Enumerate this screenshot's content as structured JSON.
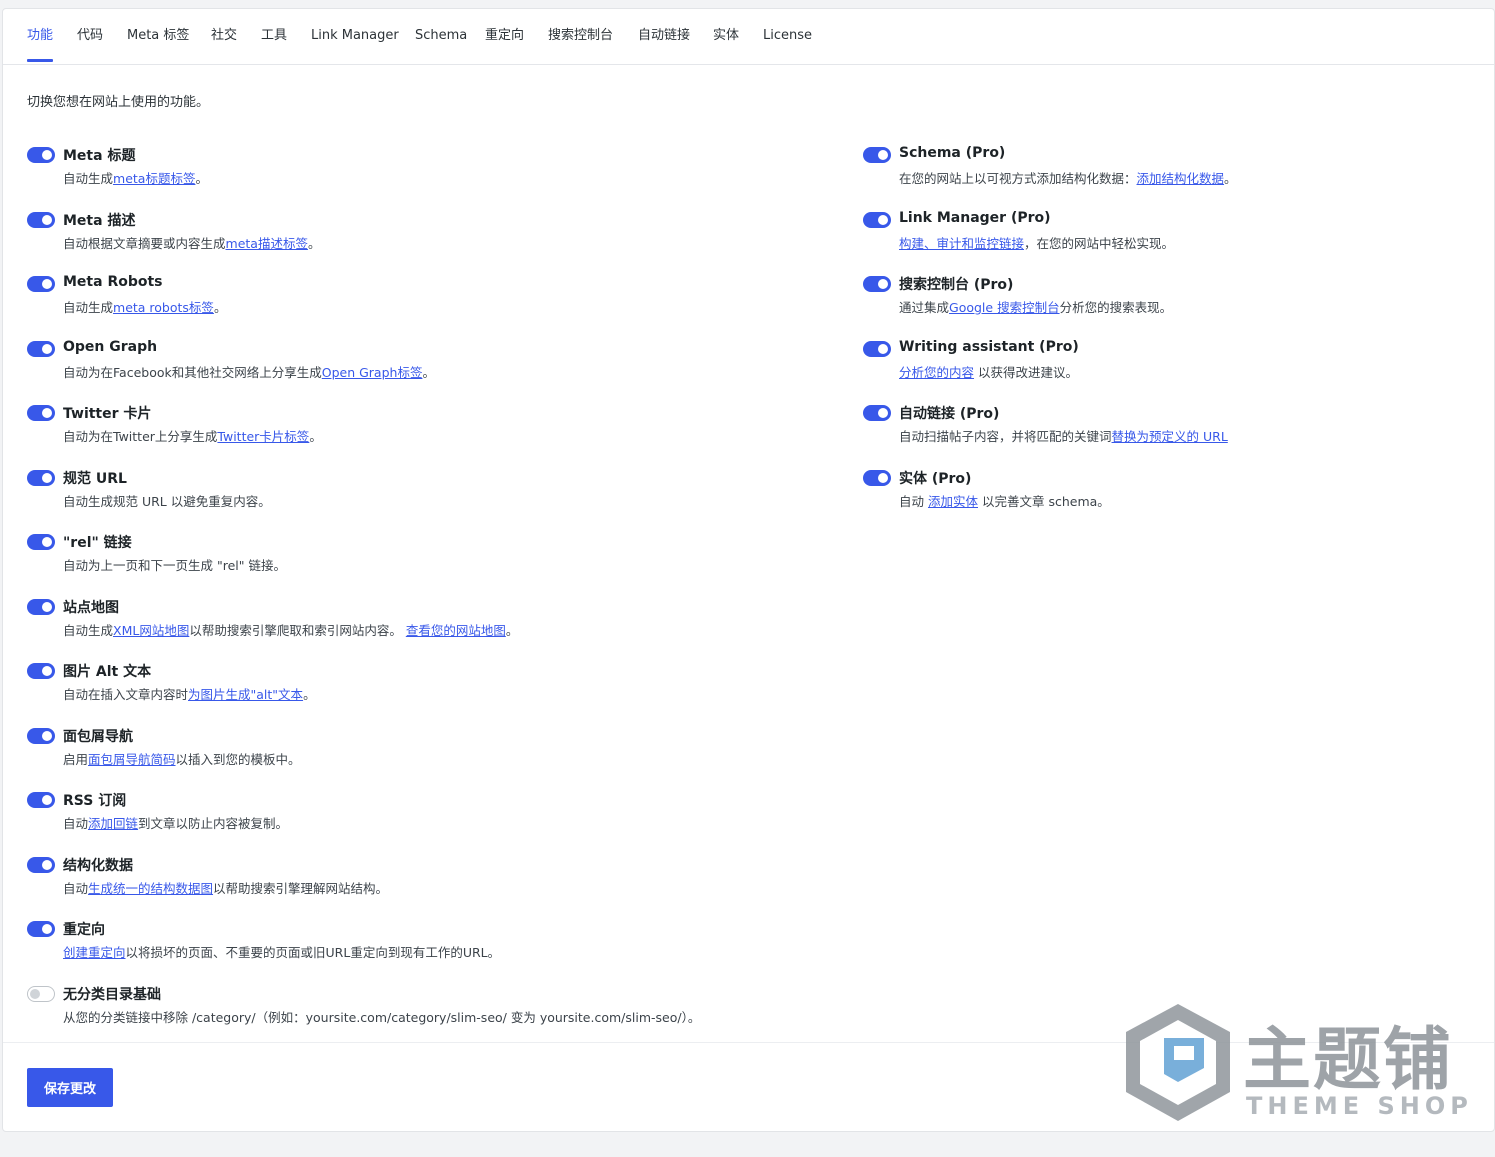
{
  "tabs": [
    "功能",
    "代码",
    "Meta 标签",
    "社交",
    "工具",
    "Link Manager",
    "Schema",
    "重定向",
    "搜索控制台",
    "自动链接",
    "实体",
    "License"
  ],
  "intro": "切换您想在网站上使用的功能。",
  "left_features": [
    {
      "title": "Meta 标题",
      "enabled": true,
      "desc": [
        {
          "t": "自动生成"
        },
        {
          "t": "meta标题标签",
          "link": true
        },
        {
          "t": "。"
        }
      ]
    },
    {
      "title": "Meta 描述",
      "enabled": true,
      "desc": [
        {
          "t": "自动根据文章摘要或内容生成"
        },
        {
          "t": "meta描述标签",
          "link": true
        },
        {
          "t": "。"
        }
      ]
    },
    {
      "title": "Meta Robots",
      "enabled": true,
      "desc": [
        {
          "t": "自动生成"
        },
        {
          "t": "meta robots标签",
          "link": true
        },
        {
          "t": "。"
        }
      ]
    },
    {
      "title": "Open Graph",
      "enabled": true,
      "desc": [
        {
          "t": "自动为在Facebook和其他社交网络上分享生成"
        },
        {
          "t": "Open Graph标签",
          "link": true
        },
        {
          "t": "。"
        }
      ]
    },
    {
      "title": "Twitter 卡片",
      "enabled": true,
      "desc": [
        {
          "t": "自动为在Twitter上分享生成"
        },
        {
          "t": "Twitter卡片标签",
          "link": true
        },
        {
          "t": "。"
        }
      ]
    },
    {
      "title": "规范 URL",
      "enabled": true,
      "desc": [
        {
          "t": "自动生成规范 URL 以避免重复内容。"
        }
      ]
    },
    {
      "title": "\"rel\" 链接",
      "enabled": true,
      "desc": [
        {
          "t": "自动为上一页和下一页生成 \"rel\" 链接。"
        }
      ]
    },
    {
      "title": "站点地图",
      "enabled": true,
      "desc": [
        {
          "t": "自动生成"
        },
        {
          "t": "XML网站地图",
          "link": true
        },
        {
          "t": "以帮助搜索引擎爬取和索引网站内容。 "
        },
        {
          "t": "查看您的网站地图",
          "link": true
        },
        {
          "t": "。"
        }
      ]
    },
    {
      "title": "图片 Alt 文本",
      "enabled": true,
      "desc": [
        {
          "t": "自动在插入文章内容时"
        },
        {
          "t": "为图片生成\"alt\"文本",
          "link": true
        },
        {
          "t": "。"
        }
      ]
    },
    {
      "title": "面包屑导航",
      "enabled": true,
      "desc": [
        {
          "t": "启用"
        },
        {
          "t": "面包屑导航简码",
          "link": true
        },
        {
          "t": "以插入到您的模板中。"
        }
      ]
    },
    {
      "title": "RSS 订阅",
      "enabled": true,
      "desc": [
        {
          "t": "自动"
        },
        {
          "t": "添加回链",
          "link": true
        },
        {
          "t": "到文章以防止内容被复制。"
        }
      ]
    },
    {
      "title": "结构化数据",
      "enabled": true,
      "desc": [
        {
          "t": "自动"
        },
        {
          "t": "生成统一的结构数据图",
          "link": true
        },
        {
          "t": "以帮助搜索引擎理解网站结构。"
        }
      ]
    },
    {
      "title": "重定向",
      "enabled": true,
      "desc": [
        {
          "t": "创建重定向",
          "link": true
        },
        {
          "t": "以将损坏的页面、不重要的页面或旧URL重定向到现有工作的URL。"
        }
      ]
    },
    {
      "title": "无分类目录基础",
      "enabled": false,
      "desc": [
        {
          "t": "从您的分类链接中移除 /category/（例如：yoursite.com/category/slim-seo/ 变为 yoursite.com/slim-seo/）。"
        }
      ]
    }
  ],
  "right_features": [
    {
      "title": "Schema (Pro)",
      "enabled": true,
      "desc": [
        {
          "t": "在您的网站上以可视方式添加结构化数据："
        },
        {
          "t": "添加结构化数据",
          "link": true
        },
        {
          "t": "。"
        }
      ]
    },
    {
      "title": "Link Manager (Pro)",
      "enabled": true,
      "desc": [
        {
          "t": "构建、审计和监控链接",
          "link": true
        },
        {
          "t": "，在您的网站中轻松实现。"
        }
      ]
    },
    {
      "title": "搜索控制台 (Pro)",
      "enabled": true,
      "desc": [
        {
          "t": "通过集成"
        },
        {
          "t": "Google 搜索控制台",
          "link": true
        },
        {
          "t": "分析您的搜索表现。"
        }
      ]
    },
    {
      "title": "Writing assistant (Pro)",
      "enabled": true,
      "desc": [
        {
          "t": "分析您的内容",
          "link": true
        },
        {
          "t": " 以获得改进建议。"
        }
      ]
    },
    {
      "title": "自动链接 (Pro)",
      "enabled": true,
      "desc": [
        {
          "t": "自动扫描帖子内容，并将匹配的关键词"
        },
        {
          "t": "替换为预定义的 URL",
          "link": true
        }
      ]
    },
    {
      "title": "实体 (Pro)",
      "enabled": true,
      "desc": [
        {
          "t": "自动 "
        },
        {
          "t": "添加实体",
          "link": true
        },
        {
          "t": " 以完善文章 schema。"
        }
      ]
    }
  ],
  "save_label": "保存更改",
  "watermark": {
    "text": "主题铺",
    "sub": "THEME SHOP"
  },
  "colors": {
    "accent": "#3858e9"
  }
}
